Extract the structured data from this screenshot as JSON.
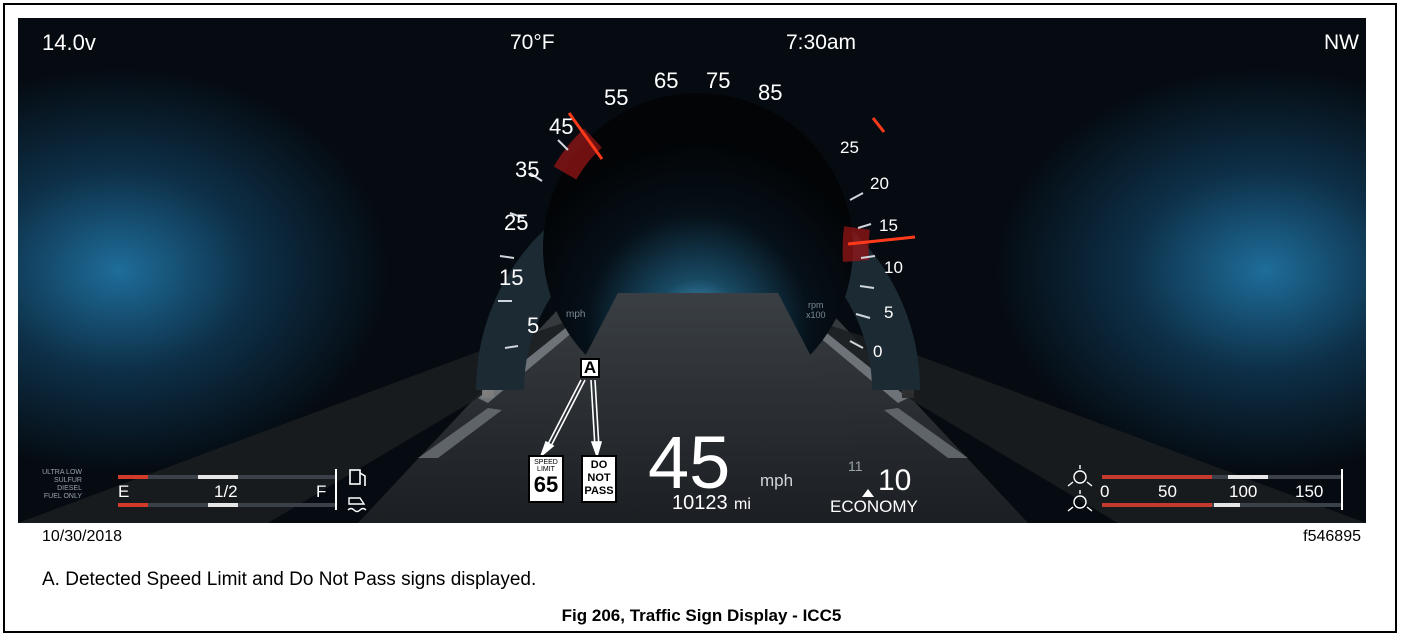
{
  "dashboard": {
    "voltage": "14.0v",
    "temperature": "70°F",
    "time": "7:30am",
    "heading": "NW",
    "speedometer": {
      "ticks": [
        "5",
        "15",
        "25",
        "35",
        "45",
        "55",
        "65",
        "75",
        "85"
      ],
      "unit": "mph",
      "needle_value": 45
    },
    "tachometer": {
      "ticks": [
        "0",
        "5",
        "10",
        "15",
        "20",
        "25"
      ],
      "unit": "rpm",
      "multiplier": "x100",
      "needle_value": 15
    },
    "speed_value": "45",
    "speed_unit": "mph",
    "odometer_value": "10123",
    "odometer_unit": "mi",
    "gear_small": "11",
    "gear": "10",
    "mode": "ECONOMY",
    "fuel_label_lines": [
      "ULTRA LOW",
      "SULFUR",
      "DIESEL",
      "FUEL ONLY"
    ],
    "fuel_scale": [
      "E",
      "1/2",
      "F"
    ],
    "pressure_scale": [
      "0",
      "50",
      "100",
      "150"
    ],
    "signs": {
      "speed_limit_top": "SPEED",
      "speed_limit_mid": "LIMIT",
      "speed_limit_value": "65",
      "dnp_line1": "DO",
      "dnp_line2": "NOT",
      "dnp_line3": "PASS"
    },
    "callout_label": "A"
  },
  "date": "10/30/2018",
  "figure_id": "f546895",
  "legend_text": "A.  Detected Speed Limit and Do Not Pass signs displayed.",
  "caption": "Fig 206, Traffic Sign Display - ICC5"
}
